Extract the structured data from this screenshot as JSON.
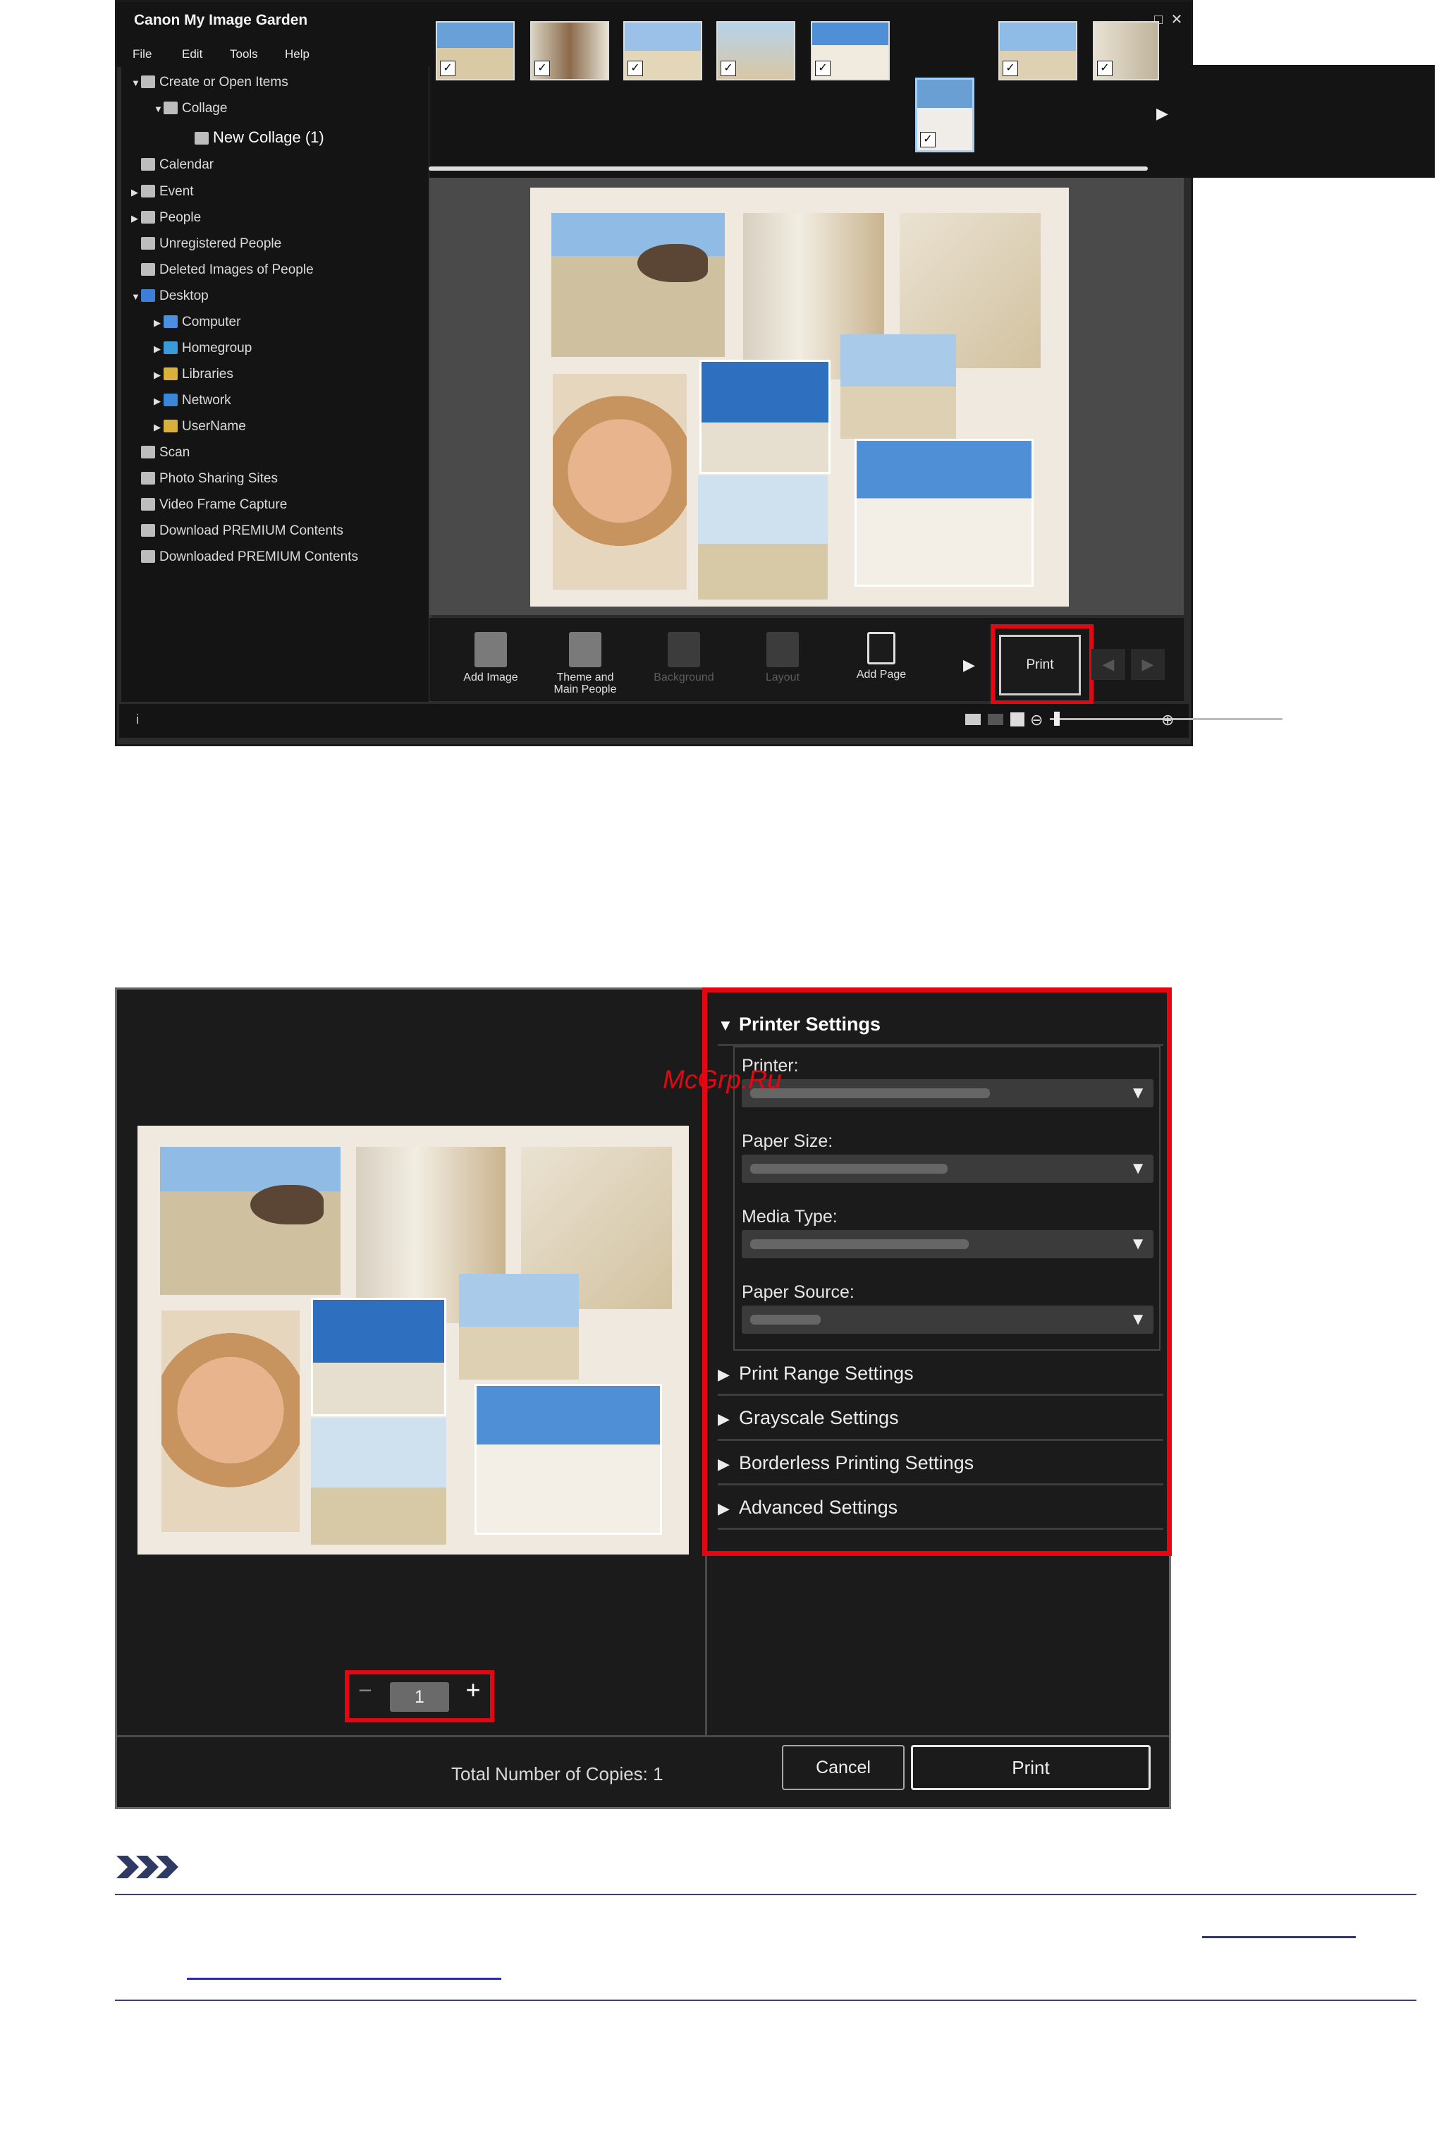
{
  "window1": {
    "title": "Canon My Image Garden",
    "controls": [
      "_",
      "□",
      "✕"
    ],
    "menu": [
      "File",
      "Edit",
      "Tools",
      "Help"
    ],
    "sidebar": [
      {
        "label": "Create or Open Items",
        "level": 0,
        "expanded": true,
        "icon": "create-icon"
      },
      {
        "label": "Collage",
        "level": 1,
        "expanded": true,
        "icon": "collage-icon"
      },
      {
        "label": "New Collage (1)",
        "level": 2,
        "selected": true,
        "icon": "collage-item-icon"
      },
      {
        "label": "Calendar",
        "level": 0,
        "icon": "calendar-icon"
      },
      {
        "label": "Event",
        "level": 0,
        "collapsed": true,
        "icon": "event-icon"
      },
      {
        "label": "People",
        "level": 0,
        "collapsed": true,
        "icon": "people-icon"
      },
      {
        "label": "Unregistered People",
        "level": 0,
        "icon": "unregistered-people-icon"
      },
      {
        "label": "Deleted Images of People",
        "level": 0,
        "icon": "deleted-people-icon"
      },
      {
        "label": "Desktop",
        "level": 0,
        "expanded": true,
        "icon": "desktop-icon"
      },
      {
        "label": "Computer",
        "level": 1,
        "collapsed": true,
        "icon": "computer-icon"
      },
      {
        "label": "Homegroup",
        "level": 1,
        "collapsed": true,
        "icon": "homegroup-icon"
      },
      {
        "label": "Libraries",
        "level": 1,
        "collapsed": true,
        "icon": "libraries-icon"
      },
      {
        "label": "Network",
        "level": 1,
        "collapsed": true,
        "icon": "network-icon"
      },
      {
        "label": "UserName",
        "level": 1,
        "collapsed": true,
        "icon": "user-folder-icon"
      },
      {
        "label": "Scan",
        "level": 0,
        "icon": "scan-icon"
      },
      {
        "label": "Photo Sharing Sites",
        "level": 0,
        "icon": "photo-sharing-icon"
      },
      {
        "label": "Video Frame Capture",
        "level": 0,
        "icon": "video-frame-icon"
      },
      {
        "label": "Download PREMIUM Contents",
        "level": 0,
        "icon": "download-icon"
      },
      {
        "label": "Downloaded PREMIUM Contents",
        "level": 0,
        "icon": "downloaded-icon"
      }
    ],
    "thumbnails_count": 8,
    "toolbar": {
      "add_image": "Add Image",
      "theme_line1": "Theme and",
      "theme_line2": "Main People",
      "background": "Background",
      "layout": "Layout",
      "add_page": "Add Page",
      "print": "Print"
    },
    "status_info": "i"
  },
  "window2": {
    "watermark": "McGrp.Ru",
    "printer_settings": {
      "title": "Printer Settings",
      "printer_label": "Printer:",
      "paper_size_label": "Paper Size:",
      "media_type_label": "Media Type:",
      "paper_source_label": "Paper Source:"
    },
    "sections": [
      "Print Range Settings",
      "Grayscale Settings",
      "Borderless Printing Settings",
      "Advanced Settings"
    ],
    "copies_value": "1",
    "total_copies_label": "Total Number of Copies:",
    "total_copies_value": "1",
    "cancel": "Cancel",
    "print": "Print"
  },
  "colors": {
    "highlight": "#e30613",
    "window_bg": "#1b1b1b",
    "link": "#2c2ca8"
  }
}
